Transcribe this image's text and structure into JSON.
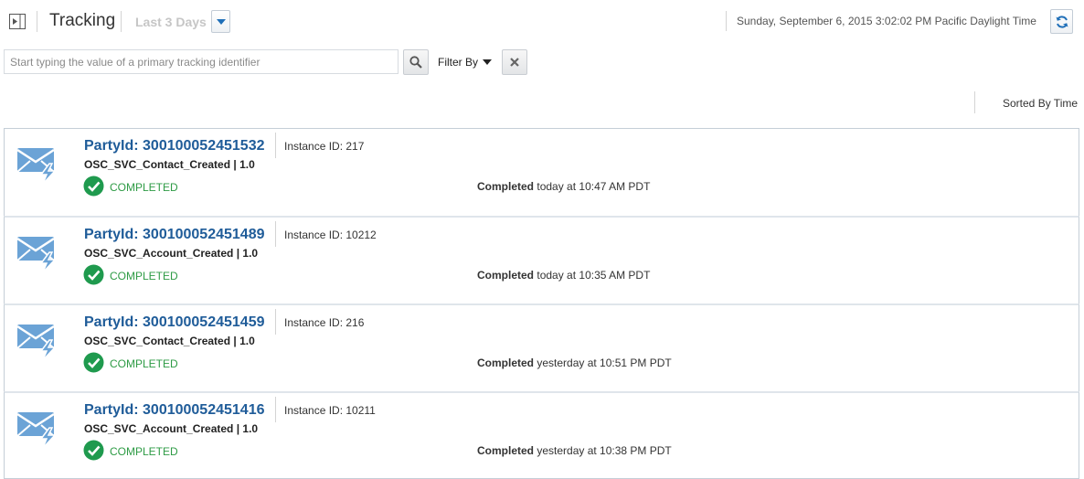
{
  "header": {
    "title": "Tracking",
    "range_label": "Last 3 Days",
    "datetime": "Sunday, September 6, 2015 3:02:02 PM Pacific Daylight Time"
  },
  "search": {
    "placeholder": "Start typing the value of a primary tracking identifier",
    "value": "",
    "filter_label": "Filter By"
  },
  "sort_label": "Sorted By Time",
  "instances": [
    {
      "party_id": "PartyId: 300100052451532",
      "instance_id": "Instance ID: 217",
      "flow": "OSC_SVC_Contact_Created | 1.0",
      "status": "COMPLETED",
      "completed_label": "Completed",
      "completed_time": "today at 10:47 AM PDT"
    },
    {
      "party_id": "PartyId: 300100052451489",
      "instance_id": "Instance ID: 10212",
      "flow": "OSC_SVC_Account_Created | 1.0",
      "status": "COMPLETED",
      "completed_label": "Completed",
      "completed_time": "today at 10:35 AM PDT"
    },
    {
      "party_id": "PartyId: 300100052451459",
      "instance_id": "Instance ID: 216",
      "flow": "OSC_SVC_Contact_Created | 1.0",
      "status": "COMPLETED",
      "completed_label": "Completed",
      "completed_time": "yesterday at 10:51 PM PDT"
    },
    {
      "party_id": "PartyId: 300100052451416",
      "instance_id": "Instance ID: 10211",
      "flow": "OSC_SVC_Account_Created | 1.0",
      "status": "COMPLETED",
      "completed_label": "Completed",
      "completed_time": "yesterday at 10:38 PM PDT"
    }
  ],
  "colors": {
    "link": "#1f5c99",
    "status_green": "#2e9b45",
    "icon_blue": "#6ba3d6"
  },
  "icons": {
    "collapse": "collapse-panel-icon",
    "dropdown": "chevron-down-icon",
    "refresh": "refresh-icon",
    "search": "search-icon",
    "clear": "close-icon",
    "message": "envelope-lightning-icon",
    "status": "check-circle-icon"
  }
}
